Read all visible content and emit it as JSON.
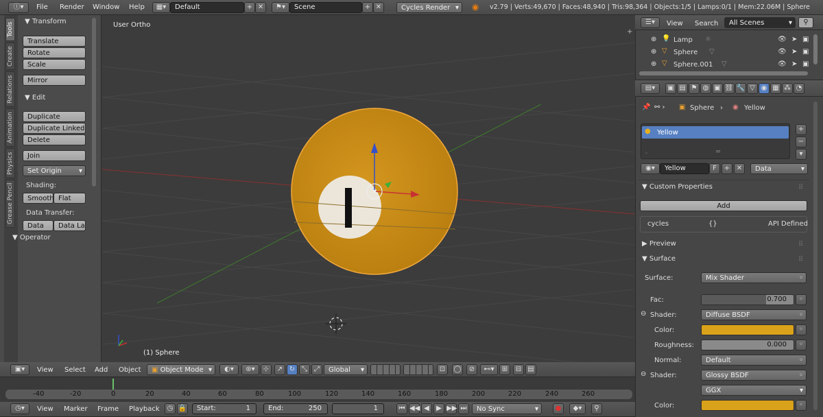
{
  "topbar": {
    "menus": [
      "File",
      "Render",
      "Window",
      "Help"
    ],
    "layout": "Default",
    "scene": "Scene",
    "engine": "Cycles Render",
    "stats": "v2.79 | Verts:49,670 | Faces:48,940 | Tris:98,364 | Objects:1/5 | Lamps:0/1 | Mem:22.06M | Sphere"
  },
  "toolshelf": {
    "tabs": [
      "Tools",
      "Create",
      "Relations",
      "Animation",
      "Physics",
      "Grease Pencil"
    ],
    "transform_title": "Transform",
    "transform_buttons": [
      "Translate",
      "Rotate",
      "Scale"
    ],
    "mirror": "Mirror",
    "edit_title": "Edit",
    "edit_buttons": [
      "Duplicate",
      "Duplicate Linked",
      "Delete"
    ],
    "join": "Join",
    "set_origin": "Set Origin",
    "shading_label": "Shading:",
    "smooth": "Smooth",
    "flat": "Flat",
    "data_transfer_label": "Data Transfer:",
    "data": "Data",
    "data_la": "Data La",
    "operator_title": "Operator"
  },
  "viewport": {
    "view_label": "User Ortho",
    "object_label": "(1) Sphere",
    "colors": {
      "sphere": "#c98a14",
      "sphere_outline": "#f2a93b",
      "grid": "#4a4a4a",
      "x_axis": "#9b3030",
      "y_axis": "#3f7a2e"
    }
  },
  "viewport_header": {
    "menus": [
      "View",
      "Select",
      "Add",
      "Object"
    ],
    "mode": "Object Mode",
    "orientation": "Global"
  },
  "timeline": {
    "ruler": [
      "-40",
      "-20",
      "0",
      "20",
      "40",
      "60",
      "80",
      "100",
      "120",
      "140",
      "160",
      "180",
      "200",
      "220",
      "240",
      "260"
    ],
    "menus": [
      "View",
      "Marker",
      "Frame",
      "Playback"
    ],
    "start_label": "Start:",
    "start_value": "1",
    "end_label": "End:",
    "end_value": "250",
    "current": "1",
    "sync": "No Sync"
  },
  "outliner": {
    "menus": [
      "View",
      "Search"
    ],
    "filter": "All Scenes",
    "items": [
      {
        "name": "Lamp"
      },
      {
        "name": "Sphere"
      },
      {
        "name": "Sphere.001"
      }
    ]
  },
  "properties": {
    "breadcrumb_object": "Sphere",
    "breadcrumb_material": "Yellow",
    "slot_name": "Yellow",
    "material_name": "Yellow",
    "fake_user": "F",
    "link": "Data",
    "custom_properties_title": "Custom Properties",
    "add": "Add",
    "cycles_name": "cycles",
    "cycles_value": "{}",
    "cycles_api": "API Defined",
    "preview_title": "Preview",
    "surface_title": "Surface",
    "surface_label": "Surface:",
    "surface_value": "Mix Shader",
    "fac_label": "Fac:",
    "fac_value": "0.700",
    "fac": 0.7,
    "shader1_label": "Shader:",
    "shader1_value": "Diffuse BSDF",
    "color_label": "Color:",
    "color1": "#d9a21a",
    "roughness_label": "Roughness:",
    "roughness_value": "0.000",
    "normal_label": "Normal:",
    "normal_value": "Default",
    "shader2_label": "Shader:",
    "shader2_value": "Glossy BSDF",
    "distribution_value": "GGX",
    "color2_label": "Color:",
    "color2": "#d9a21a"
  }
}
